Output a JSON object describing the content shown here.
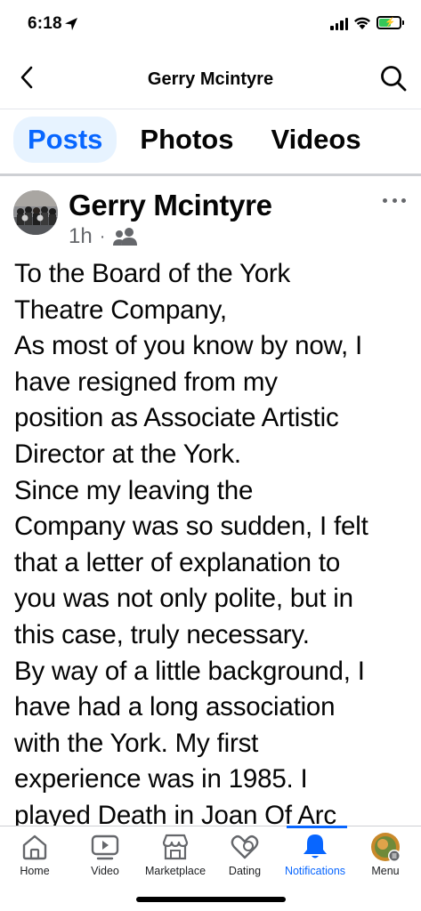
{
  "status_bar": {
    "time": "6:18"
  },
  "header": {
    "title": "Gerry Mcintyre"
  },
  "tabs": [
    {
      "label": "Posts",
      "active": true
    },
    {
      "label": "Photos",
      "active": false
    },
    {
      "label": "Videos",
      "active": false
    }
  ],
  "post": {
    "author": "Gerry Mcintyre",
    "time": "1h",
    "separator": "·",
    "audience_icon": "friends-icon",
    "lines": [
      "To the Board of the York",
      "Theatre Company,",
      "As most of you know by now, I",
      "have resigned from my",
      "position as Associate Artistic",
      "Director at the York.",
      "Since my leaving the",
      "Company was so sudden, I felt",
      "that a letter of explanation to",
      "you was not only polite, but in",
      "this case, truly necessary.",
      "By way of a little background, I",
      "have had a long association",
      "with the York. My first",
      "experience was in 1985. I",
      "played Death in Joan Of Arc"
    ]
  },
  "bottom_nav": {
    "active_color": "#0866ff",
    "items": [
      {
        "label": "Home",
        "icon": "home-icon"
      },
      {
        "label": "Video",
        "icon": "video-icon"
      },
      {
        "label": "Marketplace",
        "icon": "marketplace-icon"
      },
      {
        "label": "Dating",
        "icon": "dating-icon"
      },
      {
        "label": "Notifications",
        "icon": "bell-icon",
        "active": true
      },
      {
        "label": "Menu",
        "icon": "profile-menu-icon"
      }
    ]
  }
}
